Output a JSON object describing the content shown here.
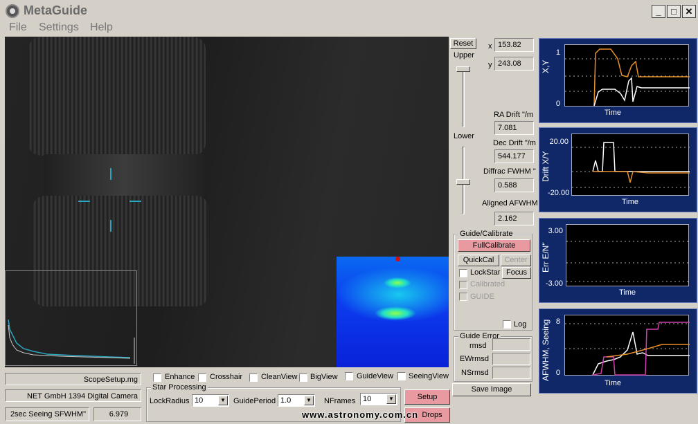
{
  "window": {
    "title": "MetaGuide",
    "minimize": "_",
    "maximize": "□",
    "close": "✕"
  },
  "menu": [
    "File",
    "Settings",
    "Help"
  ],
  "image_controls": {
    "reset": "Reset",
    "upper": "Upper",
    "lower": "Lower"
  },
  "position": {
    "x_label": "x",
    "x_value": "153.82",
    "y_label": "y",
    "y_value": "243.08"
  },
  "stats": {
    "ra_drift_label": "RA Drift \"/m",
    "ra_drift_value": "7.081",
    "dec_drift_label": "Dec Drift \"/m",
    "dec_drift_value": "544.177",
    "diffrac_label": "Diffrac FWHM \"",
    "diffrac_value": "0.588",
    "aligned_label": "Aligned AFWHM \"",
    "aligned_value": "2.162"
  },
  "guide_calibrate": {
    "title": "Guide/Calibrate",
    "full_calibrate": "FullCalibrate",
    "quick_cal": "QuickCal",
    "center": "Center",
    "lock_star": "LockStar",
    "focus": "Focus",
    "calibrated": "Calibrated",
    "guide": "GUIDE",
    "log": "Log"
  },
  "guide_error": {
    "title": "Guide Error",
    "rmsd": "rmsd",
    "ewrmsd": "EWrmsd",
    "nsrmsd": "NSrmsd"
  },
  "save_image": "Save Image",
  "status": {
    "scope_file": "ScopeSetup.mg",
    "camera": "NET GmbH 1394 Digital Camera",
    "seeing_label": "2sec Seeing SFWHM\"",
    "seeing_value": "6.979"
  },
  "view_options": [
    "Enhance",
    "Crosshair",
    "CleanView",
    "BigView",
    "GuideView",
    "SeeingView"
  ],
  "star_processing": {
    "title": "Star Processing",
    "lock_radius_label": "LockRadius",
    "lock_radius_value": "10",
    "guide_period_label": "GuidePeriod",
    "guide_period_value": "1.0",
    "nframes_label": "NFrames",
    "nframes_value": "10"
  },
  "buttons": {
    "setup": "Setup",
    "drops": "Drops"
  },
  "watermark": "www.astronomy.com.cn",
  "plots": [
    {
      "ylabel": "X,Y",
      "xlabel": "Time",
      "ticks": [
        "1",
        "0"
      ]
    },
    {
      "ylabel": "Drift X/Y",
      "xlabel": "Time",
      "ticks": [
        "20.00",
        "-20.00"
      ]
    },
    {
      "ylabel": "Err E/N\"",
      "xlabel": "Time",
      "ticks": [
        "3.00",
        "-3.00"
      ]
    },
    {
      "ylabel": "AFWHM, Seeing",
      "xlabel": "Time",
      "ticks": [
        "8",
        "0"
      ]
    }
  ],
  "colors": {
    "plot_bg": "#102868",
    "orange": "#e8902a",
    "white": "#ffffff",
    "magenta": "#d040b0",
    "cyan": "#2aa7c0",
    "pink_button": "#e89aa0"
  }
}
